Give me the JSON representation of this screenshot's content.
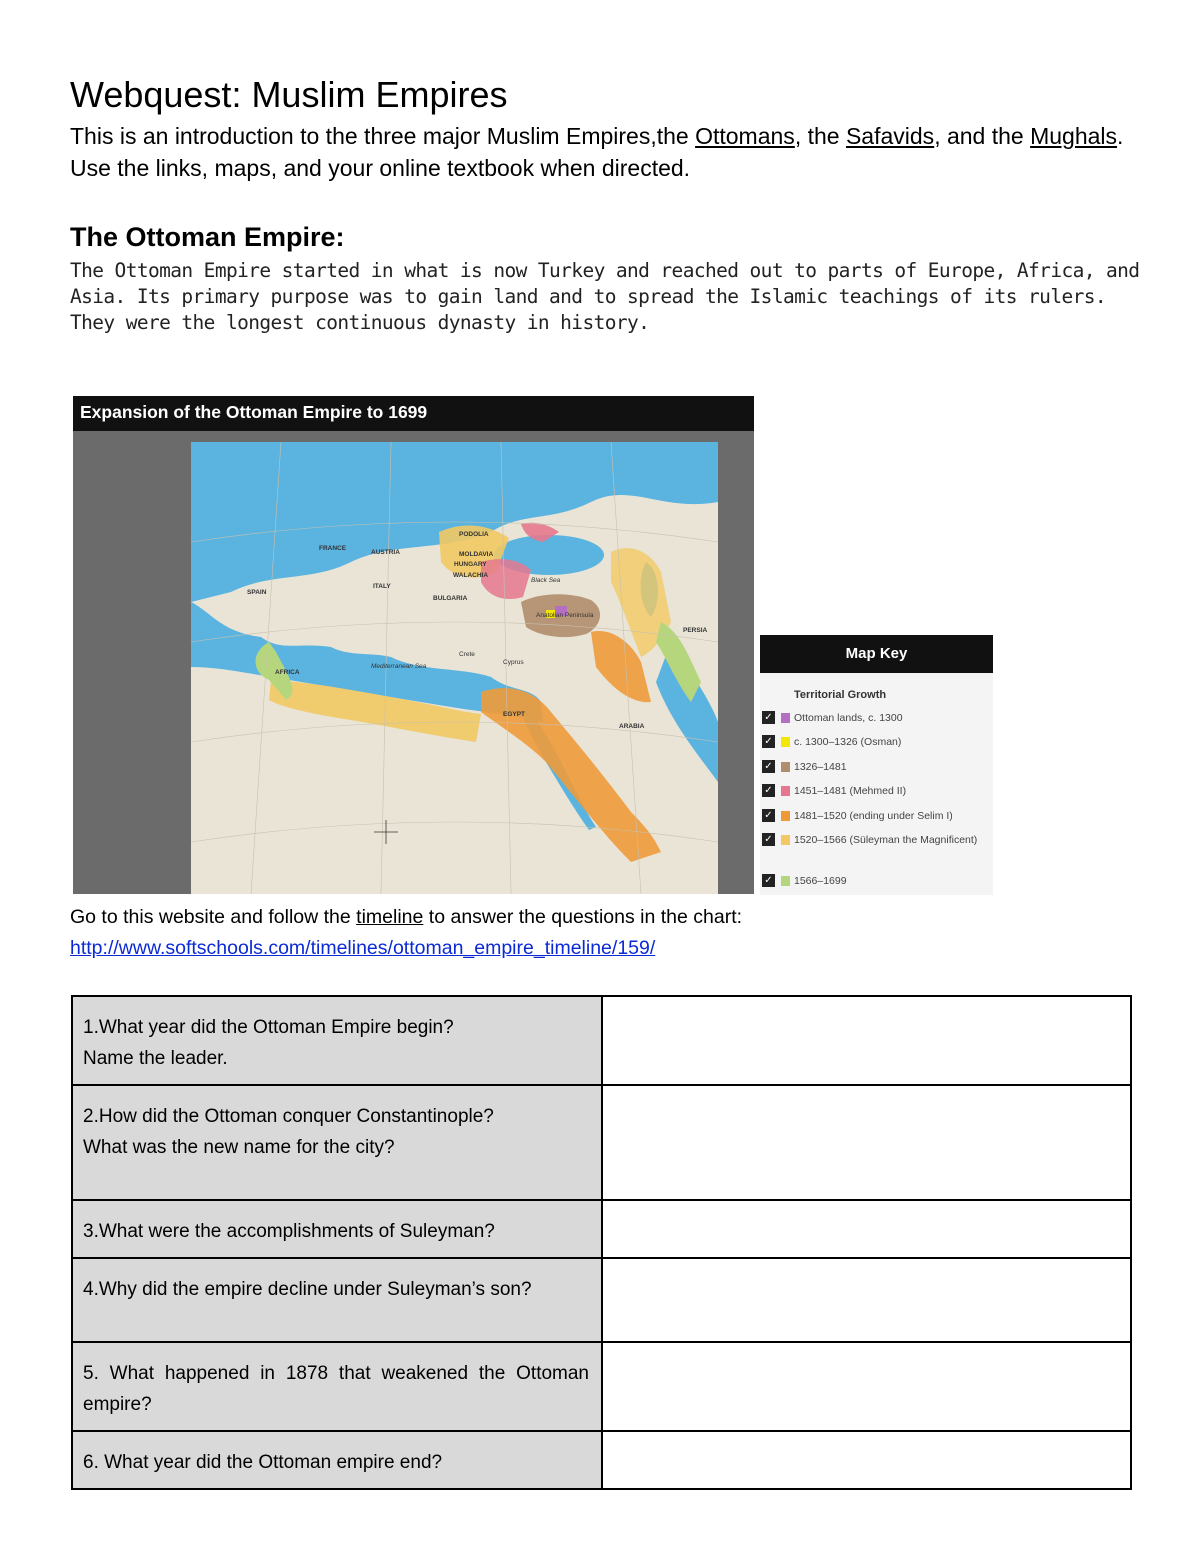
{
  "document": {
    "title": "Webquest: Muslim Empires",
    "intro": {
      "part1": "This is an introduction to the three major Muslim Empires,the ",
      "link1": "Ottomans",
      "part2": ", the ",
      "link2": "Safavids",
      "part3": ", and the ",
      "link3": "Mughals",
      "part4": ". Use the links, maps, and your online textbook when directed."
    },
    "section_title": "The Ottoman Empire:",
    "section_text": "The Ottoman Empire started in what is now Turkey and reached out to parts of Europe, Africa, and Asia. Its primary purpose was to gain land and to spread the Islamic teachings of its rulers. They were the longest continuous dynasty in history."
  },
  "map": {
    "title": "Expansion of the Ottoman Empire to 1699",
    "labels": {
      "france": "FRANCE",
      "austria": "AUSTRIA",
      "spain": "SPAIN",
      "italy": "ITALY",
      "africa": "AFRICA",
      "hungary": "HUNGARY",
      "moldavia": "MOLDAVIA",
      "podolia": "PODOLIA",
      "walachia": "WALACHIA",
      "bulgaria": "BULGARIA",
      "black_sea": "Black Sea",
      "anatolian": "Anatolian Peninsula",
      "med_sea": "Mediterranean Sea",
      "persia": "PERSIA",
      "egypt": "EGYPT",
      "arabia": "ARABIA",
      "crete": "Crete",
      "cyprus": "Cyprus"
    },
    "colors": {
      "ocean": "#5bb4e0",
      "land": "#e9e4d6",
      "ottoman_1300": "#b56fc2",
      "osman": "#f3e600",
      "p1326": "#b08d6b",
      "mehmed": "#e5788e",
      "selim": "#ee9a3a",
      "suleyman": "#f2c964",
      "p1566": "#b6d67e"
    }
  },
  "map_key": {
    "title": "Map Key",
    "subtitle": "Territorial Growth",
    "items": [
      {
        "label": "Ottoman lands, c. 1300",
        "color": "#b56fc2"
      },
      {
        "label": "c. 1300–1326 (Osman)",
        "color": "#f3e600"
      },
      {
        "label": "1326–1481",
        "color": "#b08d6b"
      },
      {
        "label": "1451–1481 (Mehmed II)",
        "color": "#e5788e"
      },
      {
        "label": "1481–1520 (ending under Selim I)",
        "color": "#ee9a3a"
      },
      {
        "label": "1520–1566 (Süleyman the Magnificent)",
        "color": "#f2c964"
      },
      {
        "label": "1566–1699",
        "color": "#b6d67e"
      }
    ]
  },
  "instructions": {
    "before": "Go to this website and follow the ",
    "link": "timeline",
    "after": " to answer the questions in the chart:",
    "url": "http://www.softschools.com/timelines/ottoman_empire_timeline/159/"
  },
  "questions": [
    {
      "line1": "1.What year did the Ottoman Empire begin?",
      "line2": "Name the leader."
    },
    {
      "line1": "2.How did the Ottoman conquer Constantinople?",
      "line2": "What was the new name for the city?"
    },
    {
      "line1": "3.What were the accomplishments of Suleyman?",
      "line2": ""
    },
    {
      "line1": "4.Why did the empire decline under Suleyman’s son?",
      "line2": ""
    },
    {
      "line1": "5. What happened in 1878 that weakened the Ottoman empire?",
      "line2": ""
    },
    {
      "line1": "6. What year did the Ottoman empire end?",
      "line2": ""
    }
  ]
}
